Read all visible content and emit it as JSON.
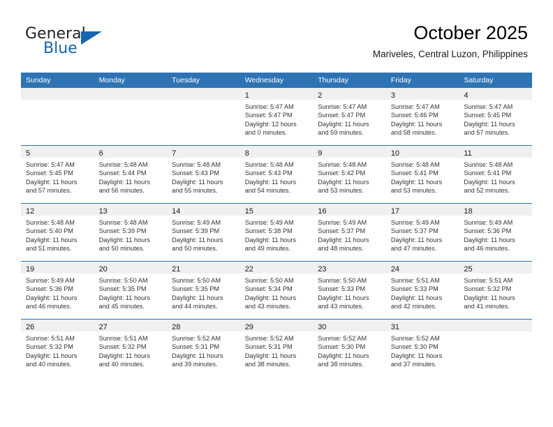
{
  "brand": {
    "name_part1": "General",
    "name_part2": "Blue",
    "accent_color": "#1565b0"
  },
  "header": {
    "month_title": "October 2025",
    "location": "Mariveles, Central Luzon, Philippines"
  },
  "calendar": {
    "header_color": "#2e74b5",
    "daynum_band_color": "#f0f0f0",
    "weekday_headers": [
      "Sunday",
      "Monday",
      "Tuesday",
      "Wednesday",
      "Thursday",
      "Friday",
      "Saturday"
    ],
    "weeks": [
      [
        {
          "day": "",
          "empty": true,
          "lines": []
        },
        {
          "day": "",
          "empty": true,
          "lines": []
        },
        {
          "day": "",
          "empty": true,
          "lines": []
        },
        {
          "day": "1",
          "empty": false,
          "lines": [
            "Sunrise: 5:47 AM",
            "Sunset: 5:47 PM",
            "Daylight: 12 hours",
            "and 0 minutes."
          ]
        },
        {
          "day": "2",
          "empty": false,
          "lines": [
            "Sunrise: 5:47 AM",
            "Sunset: 5:47 PM",
            "Daylight: 11 hours",
            "and 59 minutes."
          ]
        },
        {
          "day": "3",
          "empty": false,
          "lines": [
            "Sunrise: 5:47 AM",
            "Sunset: 5:46 PM",
            "Daylight: 11 hours",
            "and 58 minutes."
          ]
        },
        {
          "day": "4",
          "empty": false,
          "lines": [
            "Sunrise: 5:47 AM",
            "Sunset: 5:45 PM",
            "Daylight: 11 hours",
            "and 57 minutes."
          ]
        }
      ],
      [
        {
          "day": "5",
          "empty": false,
          "lines": [
            "Sunrise: 5:47 AM",
            "Sunset: 5:45 PM",
            "Daylight: 11 hours",
            "and 57 minutes."
          ]
        },
        {
          "day": "6",
          "empty": false,
          "lines": [
            "Sunrise: 5:48 AM",
            "Sunset: 5:44 PM",
            "Daylight: 11 hours",
            "and 56 minutes."
          ]
        },
        {
          "day": "7",
          "empty": false,
          "lines": [
            "Sunrise: 5:48 AM",
            "Sunset: 5:43 PM",
            "Daylight: 11 hours",
            "and 55 minutes."
          ]
        },
        {
          "day": "8",
          "empty": false,
          "lines": [
            "Sunrise: 5:48 AM",
            "Sunset: 5:43 PM",
            "Daylight: 11 hours",
            "and 54 minutes."
          ]
        },
        {
          "day": "9",
          "empty": false,
          "lines": [
            "Sunrise: 5:48 AM",
            "Sunset: 5:42 PM",
            "Daylight: 11 hours",
            "and 53 minutes."
          ]
        },
        {
          "day": "10",
          "empty": false,
          "lines": [
            "Sunrise: 5:48 AM",
            "Sunset: 5:41 PM",
            "Daylight: 11 hours",
            "and 53 minutes."
          ]
        },
        {
          "day": "11",
          "empty": false,
          "lines": [
            "Sunrise: 5:48 AM",
            "Sunset: 5:41 PM",
            "Daylight: 11 hours",
            "and 52 minutes."
          ]
        }
      ],
      [
        {
          "day": "12",
          "empty": false,
          "lines": [
            "Sunrise: 5:48 AM",
            "Sunset: 5:40 PM",
            "Daylight: 11 hours",
            "and 51 minutes."
          ]
        },
        {
          "day": "13",
          "empty": false,
          "lines": [
            "Sunrise: 5:48 AM",
            "Sunset: 5:39 PM",
            "Daylight: 11 hours",
            "and 50 minutes."
          ]
        },
        {
          "day": "14",
          "empty": false,
          "lines": [
            "Sunrise: 5:49 AM",
            "Sunset: 5:39 PM",
            "Daylight: 11 hours",
            "and 50 minutes."
          ]
        },
        {
          "day": "15",
          "empty": false,
          "lines": [
            "Sunrise: 5:49 AM",
            "Sunset: 5:38 PM",
            "Daylight: 11 hours",
            "and 49 minutes."
          ]
        },
        {
          "day": "16",
          "empty": false,
          "lines": [
            "Sunrise: 5:49 AM",
            "Sunset: 5:37 PM",
            "Daylight: 11 hours",
            "and 48 minutes."
          ]
        },
        {
          "day": "17",
          "empty": false,
          "lines": [
            "Sunrise: 5:49 AM",
            "Sunset: 5:37 PM",
            "Daylight: 11 hours",
            "and 47 minutes."
          ]
        },
        {
          "day": "18",
          "empty": false,
          "lines": [
            "Sunrise: 5:49 AM",
            "Sunset: 5:36 PM",
            "Daylight: 11 hours",
            "and 46 minutes."
          ]
        }
      ],
      [
        {
          "day": "19",
          "empty": false,
          "lines": [
            "Sunrise: 5:49 AM",
            "Sunset: 5:36 PM",
            "Daylight: 11 hours",
            "and 46 minutes."
          ]
        },
        {
          "day": "20",
          "empty": false,
          "lines": [
            "Sunrise: 5:50 AM",
            "Sunset: 5:35 PM",
            "Daylight: 11 hours",
            "and 45 minutes."
          ]
        },
        {
          "day": "21",
          "empty": false,
          "lines": [
            "Sunrise: 5:50 AM",
            "Sunset: 5:35 PM",
            "Daylight: 11 hours",
            "and 44 minutes."
          ]
        },
        {
          "day": "22",
          "empty": false,
          "lines": [
            "Sunrise: 5:50 AM",
            "Sunset: 5:34 PM",
            "Daylight: 11 hours",
            "and 43 minutes."
          ]
        },
        {
          "day": "23",
          "empty": false,
          "lines": [
            "Sunrise: 5:50 AM",
            "Sunset: 5:33 PM",
            "Daylight: 11 hours",
            "and 43 minutes."
          ]
        },
        {
          "day": "24",
          "empty": false,
          "lines": [
            "Sunrise: 5:51 AM",
            "Sunset: 5:33 PM",
            "Daylight: 11 hours",
            "and 42 minutes."
          ]
        },
        {
          "day": "25",
          "empty": false,
          "lines": [
            "Sunrise: 5:51 AM",
            "Sunset: 5:32 PM",
            "Daylight: 11 hours",
            "and 41 minutes."
          ]
        }
      ],
      [
        {
          "day": "26",
          "empty": false,
          "lines": [
            "Sunrise: 5:51 AM",
            "Sunset: 5:32 PM",
            "Daylight: 11 hours",
            "and 40 minutes."
          ]
        },
        {
          "day": "27",
          "empty": false,
          "lines": [
            "Sunrise: 5:51 AM",
            "Sunset: 5:32 PM",
            "Daylight: 11 hours",
            "and 40 minutes."
          ]
        },
        {
          "day": "28",
          "empty": false,
          "lines": [
            "Sunrise: 5:52 AM",
            "Sunset: 5:31 PM",
            "Daylight: 11 hours",
            "and 39 minutes."
          ]
        },
        {
          "day": "29",
          "empty": false,
          "lines": [
            "Sunrise: 5:52 AM",
            "Sunset: 5:31 PM",
            "Daylight: 11 hours",
            "and 38 minutes."
          ]
        },
        {
          "day": "30",
          "empty": false,
          "lines": [
            "Sunrise: 5:52 AM",
            "Sunset: 5:30 PM",
            "Daylight: 11 hours",
            "and 38 minutes."
          ]
        },
        {
          "day": "31",
          "empty": false,
          "lines": [
            "Sunrise: 5:52 AM",
            "Sunset: 5:30 PM",
            "Daylight: 11 hours",
            "and 37 minutes."
          ]
        },
        {
          "day": "",
          "empty": true,
          "lines": []
        }
      ]
    ]
  }
}
